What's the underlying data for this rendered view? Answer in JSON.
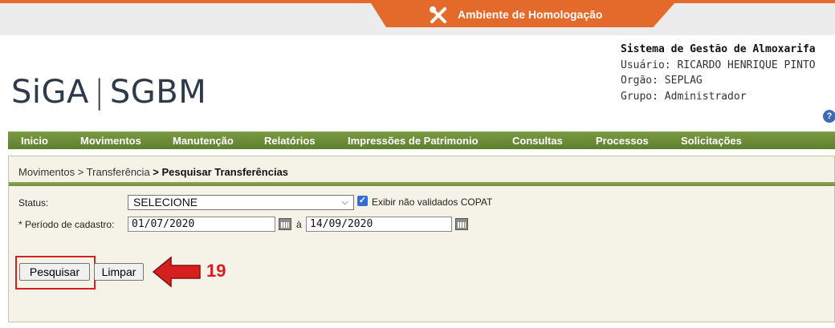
{
  "env_banner": {
    "label": "Ambiente de Homologação"
  },
  "logo": {
    "left": "SiGA",
    "sep": "|",
    "right": "SGBM"
  },
  "system": {
    "title": "Sistema de Gestão de Almoxarifa",
    "user": "Usuário: RICARDO HENRIQUE PINTO",
    "org": "Orgão: SEPLAG",
    "group": "Grupo: Administrador"
  },
  "nav": {
    "items": [
      "Inicio",
      "Movimentos",
      "Manutenção",
      "Relatórios",
      "Impressões de Patrimonio",
      "Consultas",
      "Processos",
      "Solicitações"
    ]
  },
  "breadcrumb": {
    "part1": "Movimentos",
    "part2": "> Transferência",
    "current": "> Pesquisar Transferências"
  },
  "form": {
    "status_label": "Status:",
    "status_value": "SELECIONE",
    "checkbox_label": "Exibir não validados COPAT",
    "period_label": "* Período de cadastro:",
    "date_from": "01/07/2020",
    "date_sep": "à",
    "date_to": "14/09/2020"
  },
  "buttons": {
    "search": "Pesquisar",
    "clear": "Limpar"
  },
  "annotation": {
    "step": "19",
    "color": "#d62020"
  },
  "colors": {
    "accent": "#e46a2c",
    "nav": "#6b8a38"
  }
}
